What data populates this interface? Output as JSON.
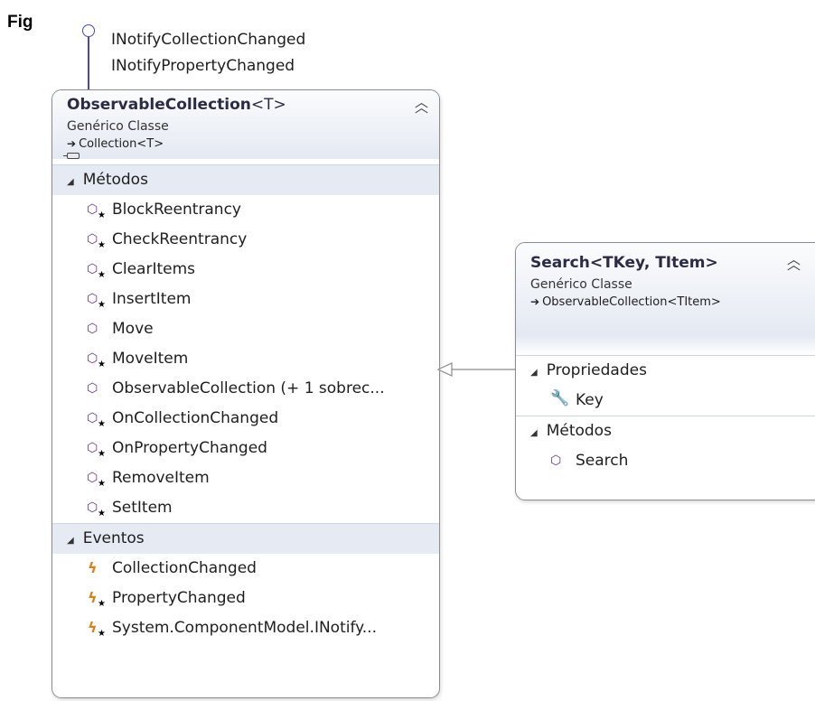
{
  "figure_label": "Fig",
  "interfaces": [
    "INotifyCollectionChanged",
    "INotifyPropertyChanged"
  ],
  "observable_collection": {
    "name": "ObservableCollection",
    "type_params": "<T>",
    "kind": "Genérico Classe",
    "base": "Collection<T>",
    "sections": {
      "methods": {
        "title": "Métodos",
        "items": [
          {
            "name": "BlockReentrancy",
            "icon": "method-protected-icon"
          },
          {
            "name": "CheckReentrancy",
            "icon": "method-protected-icon"
          },
          {
            "name": "ClearItems",
            "icon": "method-protected-icon"
          },
          {
            "name": "InsertItem",
            "icon": "method-protected-icon"
          },
          {
            "name": "Move",
            "icon": "method-icon"
          },
          {
            "name": "MoveItem",
            "icon": "method-protected-icon"
          },
          {
            "name": "ObservableCollection (+ 1 sobrec...",
            "icon": "method-icon"
          },
          {
            "name": "OnCollectionChanged",
            "icon": "method-protected-icon"
          },
          {
            "name": "OnPropertyChanged",
            "icon": "method-protected-icon"
          },
          {
            "name": "RemoveItem",
            "icon": "method-protected-icon"
          },
          {
            "name": "SetItem",
            "icon": "method-protected-icon"
          }
        ]
      },
      "events": {
        "title": "Eventos",
        "items": [
          {
            "name": "CollectionChanged",
            "icon": "event-icon"
          },
          {
            "name": "PropertyChanged",
            "icon": "event-protected-icon"
          },
          {
            "name": "System.ComponentModel.INotify...",
            "icon": "event-protected-icon"
          }
        ]
      }
    }
  },
  "search": {
    "name": "Search",
    "type_params": "<TKey, TItem>",
    "kind": "Genérico Classe",
    "base": "ObservableCollection<TItem>",
    "sections": {
      "properties": {
        "title": "Propriedades",
        "items": [
          {
            "name": "Key",
            "icon": "wrench-icon"
          }
        ]
      },
      "methods": {
        "title": "Métodos",
        "items": [
          {
            "name": "Search",
            "icon": "method-icon"
          }
        ]
      }
    }
  },
  "colors": {
    "method_icon": "#6b2f8f",
    "event_icon": "#d8811a",
    "lollipop": "#4646c0",
    "section_header": "#e5eaf3"
  }
}
